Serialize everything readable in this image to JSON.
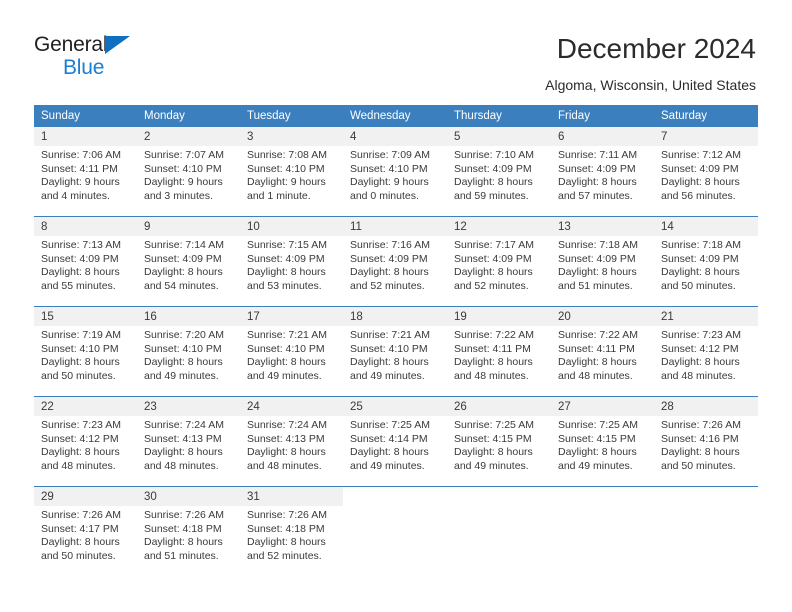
{
  "brand": {
    "name_top": "General",
    "name_bottom": "Blue",
    "accent_color": "#1b7fd4",
    "triangle_color": "#0f6fc0"
  },
  "header": {
    "title": "December 2024",
    "subtitle": "Algoma, Wisconsin, United States"
  },
  "calendar": {
    "header_bg": "#3b7fbe",
    "header_text_color": "#ffffff",
    "daynum_bg": "#f1f1f1",
    "weekday_headers": [
      "Sunday",
      "Monday",
      "Tuesday",
      "Wednesday",
      "Thursday",
      "Friday",
      "Saturday"
    ],
    "weeks": [
      {
        "days": [
          {
            "num": "1",
            "sunrise": "Sunrise: 7:06 AM",
            "sunset": "Sunset: 4:11 PM",
            "daylight_line1": "Daylight: 9 hours",
            "daylight_line2": "and 4 minutes."
          },
          {
            "num": "2",
            "sunrise": "Sunrise: 7:07 AM",
            "sunset": "Sunset: 4:10 PM",
            "daylight_line1": "Daylight: 9 hours",
            "daylight_line2": "and 3 minutes."
          },
          {
            "num": "3",
            "sunrise": "Sunrise: 7:08 AM",
            "sunset": "Sunset: 4:10 PM",
            "daylight_line1": "Daylight: 9 hours",
            "daylight_line2": "and 1 minute."
          },
          {
            "num": "4",
            "sunrise": "Sunrise: 7:09 AM",
            "sunset": "Sunset: 4:10 PM",
            "daylight_line1": "Daylight: 9 hours",
            "daylight_line2": "and 0 minutes."
          },
          {
            "num": "5",
            "sunrise": "Sunrise: 7:10 AM",
            "sunset": "Sunset: 4:09 PM",
            "daylight_line1": "Daylight: 8 hours",
            "daylight_line2": "and 59 minutes."
          },
          {
            "num": "6",
            "sunrise": "Sunrise: 7:11 AM",
            "sunset": "Sunset: 4:09 PM",
            "daylight_line1": "Daylight: 8 hours",
            "daylight_line2": "and 57 minutes."
          },
          {
            "num": "7",
            "sunrise": "Sunrise: 7:12 AM",
            "sunset": "Sunset: 4:09 PM",
            "daylight_line1": "Daylight: 8 hours",
            "daylight_line2": "and 56 minutes."
          }
        ]
      },
      {
        "days": [
          {
            "num": "8",
            "sunrise": "Sunrise: 7:13 AM",
            "sunset": "Sunset: 4:09 PM",
            "daylight_line1": "Daylight: 8 hours",
            "daylight_line2": "and 55 minutes."
          },
          {
            "num": "9",
            "sunrise": "Sunrise: 7:14 AM",
            "sunset": "Sunset: 4:09 PM",
            "daylight_line1": "Daylight: 8 hours",
            "daylight_line2": "and 54 minutes."
          },
          {
            "num": "10",
            "sunrise": "Sunrise: 7:15 AM",
            "sunset": "Sunset: 4:09 PM",
            "daylight_line1": "Daylight: 8 hours",
            "daylight_line2": "and 53 minutes."
          },
          {
            "num": "11",
            "sunrise": "Sunrise: 7:16 AM",
            "sunset": "Sunset: 4:09 PM",
            "daylight_line1": "Daylight: 8 hours",
            "daylight_line2": "and 52 minutes."
          },
          {
            "num": "12",
            "sunrise": "Sunrise: 7:17 AM",
            "sunset": "Sunset: 4:09 PM",
            "daylight_line1": "Daylight: 8 hours",
            "daylight_line2": "and 52 minutes."
          },
          {
            "num": "13",
            "sunrise": "Sunrise: 7:18 AM",
            "sunset": "Sunset: 4:09 PM",
            "daylight_line1": "Daylight: 8 hours",
            "daylight_line2": "and 51 minutes."
          },
          {
            "num": "14",
            "sunrise": "Sunrise: 7:18 AM",
            "sunset": "Sunset: 4:09 PM",
            "daylight_line1": "Daylight: 8 hours",
            "daylight_line2": "and 50 minutes."
          }
        ]
      },
      {
        "days": [
          {
            "num": "15",
            "sunrise": "Sunrise: 7:19 AM",
            "sunset": "Sunset: 4:10 PM",
            "daylight_line1": "Daylight: 8 hours",
            "daylight_line2": "and 50 minutes."
          },
          {
            "num": "16",
            "sunrise": "Sunrise: 7:20 AM",
            "sunset": "Sunset: 4:10 PM",
            "daylight_line1": "Daylight: 8 hours",
            "daylight_line2": "and 49 minutes."
          },
          {
            "num": "17",
            "sunrise": "Sunrise: 7:21 AM",
            "sunset": "Sunset: 4:10 PM",
            "daylight_line1": "Daylight: 8 hours",
            "daylight_line2": "and 49 minutes."
          },
          {
            "num": "18",
            "sunrise": "Sunrise: 7:21 AM",
            "sunset": "Sunset: 4:10 PM",
            "daylight_line1": "Daylight: 8 hours",
            "daylight_line2": "and 49 minutes."
          },
          {
            "num": "19",
            "sunrise": "Sunrise: 7:22 AM",
            "sunset": "Sunset: 4:11 PM",
            "daylight_line1": "Daylight: 8 hours",
            "daylight_line2": "and 48 minutes."
          },
          {
            "num": "20",
            "sunrise": "Sunrise: 7:22 AM",
            "sunset": "Sunset: 4:11 PM",
            "daylight_line1": "Daylight: 8 hours",
            "daylight_line2": "and 48 minutes."
          },
          {
            "num": "21",
            "sunrise": "Sunrise: 7:23 AM",
            "sunset": "Sunset: 4:12 PM",
            "daylight_line1": "Daylight: 8 hours",
            "daylight_line2": "and 48 minutes."
          }
        ]
      },
      {
        "days": [
          {
            "num": "22",
            "sunrise": "Sunrise: 7:23 AM",
            "sunset": "Sunset: 4:12 PM",
            "daylight_line1": "Daylight: 8 hours",
            "daylight_line2": "and 48 minutes."
          },
          {
            "num": "23",
            "sunrise": "Sunrise: 7:24 AM",
            "sunset": "Sunset: 4:13 PM",
            "daylight_line1": "Daylight: 8 hours",
            "daylight_line2": "and 48 minutes."
          },
          {
            "num": "24",
            "sunrise": "Sunrise: 7:24 AM",
            "sunset": "Sunset: 4:13 PM",
            "daylight_line1": "Daylight: 8 hours",
            "daylight_line2": "and 48 minutes."
          },
          {
            "num": "25",
            "sunrise": "Sunrise: 7:25 AM",
            "sunset": "Sunset: 4:14 PM",
            "daylight_line1": "Daylight: 8 hours",
            "daylight_line2": "and 49 minutes."
          },
          {
            "num": "26",
            "sunrise": "Sunrise: 7:25 AM",
            "sunset": "Sunset: 4:15 PM",
            "daylight_line1": "Daylight: 8 hours",
            "daylight_line2": "and 49 minutes."
          },
          {
            "num": "27",
            "sunrise": "Sunrise: 7:25 AM",
            "sunset": "Sunset: 4:15 PM",
            "daylight_line1": "Daylight: 8 hours",
            "daylight_line2": "and 49 minutes."
          },
          {
            "num": "28",
            "sunrise": "Sunrise: 7:26 AM",
            "sunset": "Sunset: 4:16 PM",
            "daylight_line1": "Daylight: 8 hours",
            "daylight_line2": "and 50 minutes."
          }
        ]
      },
      {
        "days": [
          {
            "num": "29",
            "sunrise": "Sunrise: 7:26 AM",
            "sunset": "Sunset: 4:17 PM",
            "daylight_line1": "Daylight: 8 hours",
            "daylight_line2": "and 50 minutes."
          },
          {
            "num": "30",
            "sunrise": "Sunrise: 7:26 AM",
            "sunset": "Sunset: 4:18 PM",
            "daylight_line1": "Daylight: 8 hours",
            "daylight_line2": "and 51 minutes."
          },
          {
            "num": "31",
            "sunrise": "Sunrise: 7:26 AM",
            "sunset": "Sunset: 4:18 PM",
            "daylight_line1": "Daylight: 8 hours",
            "daylight_line2": "and 52 minutes."
          },
          {
            "num": "",
            "sunrise": "",
            "sunset": "",
            "daylight_line1": "",
            "daylight_line2": ""
          },
          {
            "num": "",
            "sunrise": "",
            "sunset": "",
            "daylight_line1": "",
            "daylight_line2": ""
          },
          {
            "num": "",
            "sunrise": "",
            "sunset": "",
            "daylight_line1": "",
            "daylight_line2": ""
          },
          {
            "num": "",
            "sunrise": "",
            "sunset": "",
            "daylight_line1": "",
            "daylight_line2": ""
          }
        ]
      }
    ]
  }
}
